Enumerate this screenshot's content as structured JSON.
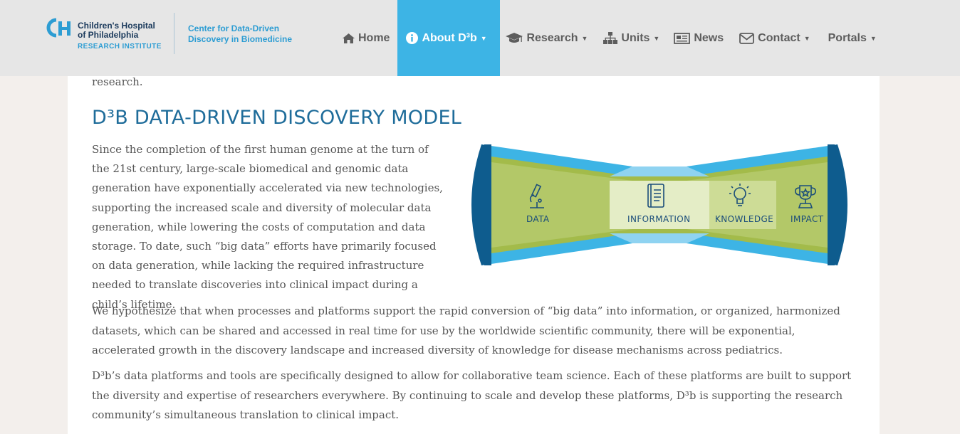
{
  "header": {
    "logo": {
      "line1": "Children's Hospital",
      "line2": "of Philadelphia",
      "line3": "RESEARCH INSTITUTE"
    },
    "center_name": {
      "line1": "Center for Data-Driven",
      "line2": "Discovery in Biomedicine"
    },
    "nav": [
      {
        "label": "Home",
        "icon": "home-icon"
      },
      {
        "label": "About D³b",
        "icon": "info-circle-icon",
        "active": true
      },
      {
        "label": "Research",
        "icon": "graduation-cap-icon"
      },
      {
        "label": "Units",
        "icon": "sitemap-icon"
      },
      {
        "label": "News",
        "icon": "newspaper-icon"
      },
      {
        "label": "Contact",
        "icon": "envelope-icon"
      },
      {
        "label": "Portals"
      }
    ],
    "accent_color": "#3db4e5"
  },
  "main": {
    "prev_text": "research.",
    "title": "D³B DATA-DRIVEN DISCOVERY MODEL",
    "paragraph1": "Since the completion of the first human genome at the turn of the 21st century, large-scale biomedical and genomic data generation have exponentially accelerated via new technologies, supporting the increased scale and diversity of molecular data generation, while lowering the costs of computation and data storage. To date, such “big data” efforts have primarily focused on data generation, while lacking the required infrastructure needed to translate discoveries into clinical impact during a child’s lifetime.",
    "paragraph2": "We hypothesize that when processes and platforms support the rapid conversion of “big data” into information, or organized, harmonized datasets, which can be shared and accessed in real time for use by the worldwide scientific community, there will be exponential, accelerated growth in the discovery landscape and increased diversity of knowledge for disease mechanisms across pediatrics.",
    "paragraph3": "D³b’s data platforms and tools are specifically designed to allow for collaborative team science. Each of these platforms are built to support the diversity and expertise of researchers everywhere. By continuing to scale and develop these platforms, D³b is supporting the research community’s simultaneous translation to clinical impact.",
    "model": {
      "stages": [
        "DATA",
        "INFORMATION",
        "KNOWLEDGE",
        "IMPACT"
      ],
      "icons": [
        "microscope-icon",
        "book-icon",
        "lightbulb-icon",
        "trophy-icon"
      ]
    }
  }
}
